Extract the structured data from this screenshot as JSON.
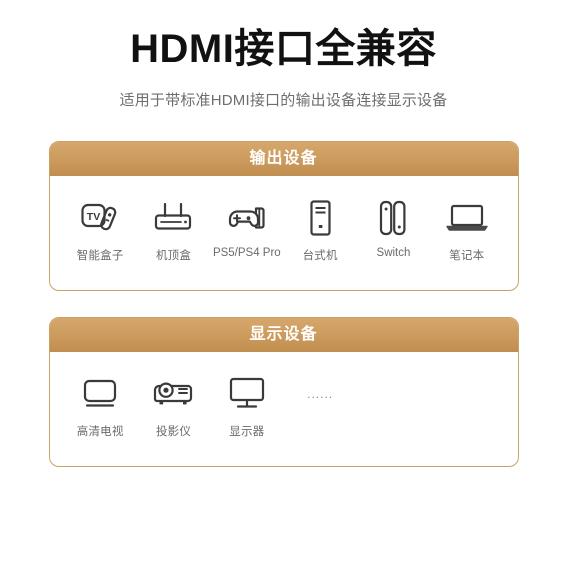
{
  "headline": "HDMI接口全兼容",
  "subheadline": "适用于带标准HDMI接口的输出设备连接显示设备",
  "colors": {
    "header_gradient_top": "#d6a76c",
    "header_gradient_bottom": "#c08e4e",
    "card_border": "#c8a268",
    "title_text": "#111111",
    "sub_text": "#6e6e6e",
    "label_text": "#6b6b6b",
    "icon_stroke": "#3a3a3a",
    "page_background": "#ffffff"
  },
  "cards": [
    {
      "title": "输出设备",
      "devices": [
        {
          "label": "智能盒子",
          "icon": "tv-box-icon"
        },
        {
          "label": "机顶盒",
          "icon": "set-top-box-icon"
        },
        {
          "label": "PS5/PS4 Pro",
          "icon": "gamepad-icon"
        },
        {
          "label": "台式机",
          "icon": "desktop-tower-icon"
        },
        {
          "label": "Switch",
          "icon": "switch-console-icon"
        },
        {
          "label": "笔记本",
          "icon": "laptop-icon"
        }
      ]
    },
    {
      "title": "显示设备",
      "devices": [
        {
          "label": "高清电视",
          "icon": "television-icon"
        },
        {
          "label": "投影仪",
          "icon": "projector-icon"
        },
        {
          "label": "显示器",
          "icon": "monitor-icon"
        }
      ],
      "more_indicator": "......"
    }
  ]
}
